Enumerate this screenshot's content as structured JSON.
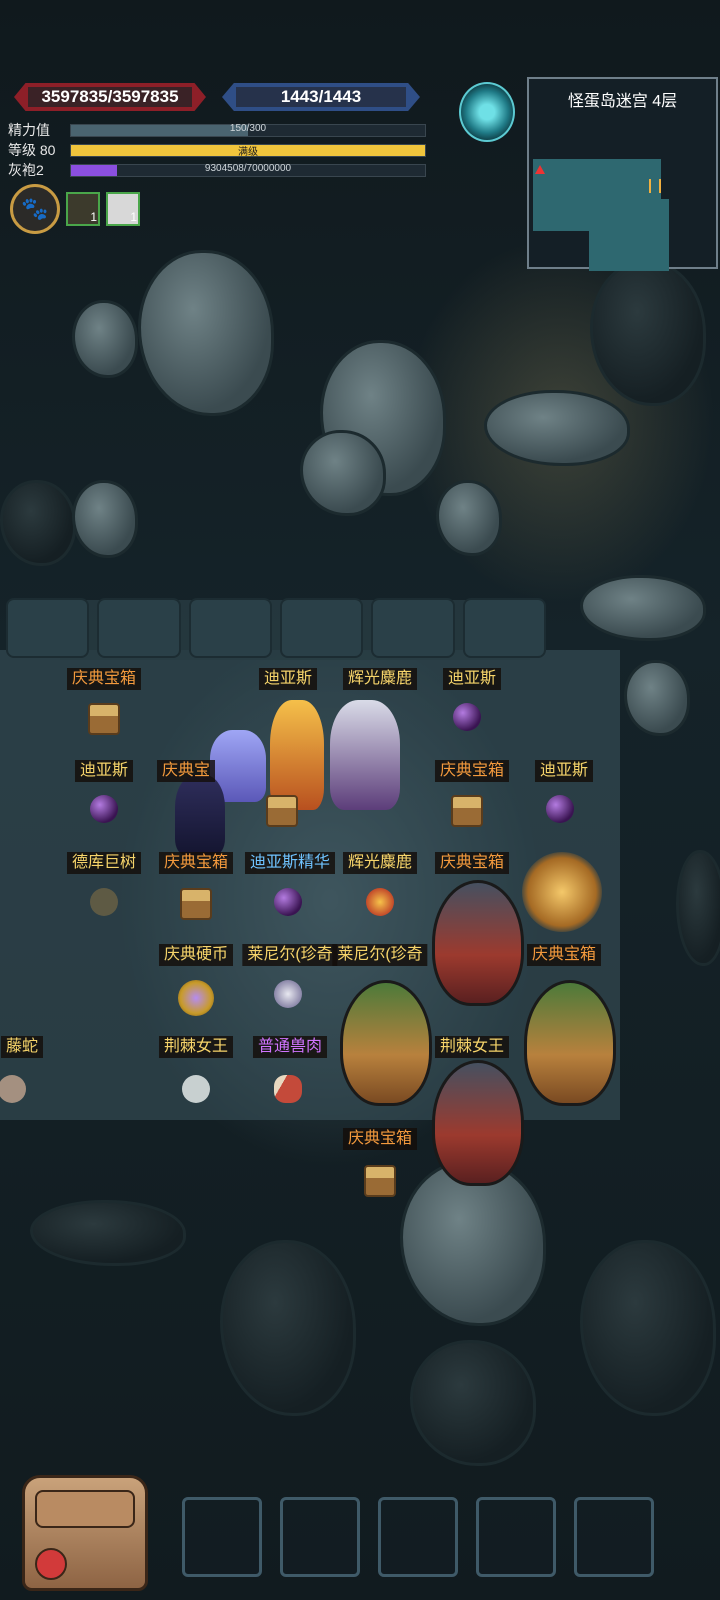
{
  "hud": {
    "hp": "3597835/3597835",
    "mp": "1443/1443",
    "stats": [
      {
        "label": "精力值",
        "text": "150/300",
        "fill": 0.5,
        "color": "#4a6470"
      },
      {
        "label": "等级 80",
        "text": "满级",
        "fill": 1.0,
        "color": "#f0c53c"
      },
      {
        "label": "灰袍2",
        "text": "9304508/70000000",
        "fill": 0.13,
        "color": "#8b4fe0"
      }
    ],
    "buffs": [
      {
        "icon": "armor-buff-icon",
        "count": "1"
      },
      {
        "icon": "ghost-buff-icon",
        "count": "1"
      }
    ]
  },
  "minimap": {
    "title": "怪蛋岛迷宫 4层"
  },
  "labels": [
    {
      "text": "庆典宝箱",
      "color": "orange"
    },
    {
      "text": "迪亚斯",
      "color": "gold"
    },
    {
      "text": "辉光麋鹿",
      "color": "gold"
    },
    {
      "text": "迪亚斯",
      "color": "gold"
    },
    {
      "text": "迪亚斯",
      "color": "gold"
    },
    {
      "text": "庆典宝",
      "color": "orange"
    },
    {
      "text": "庆典宝箱",
      "color": "orange"
    },
    {
      "text": "迪亚斯",
      "color": "gold"
    },
    {
      "text": "德库巨树",
      "color": "gold"
    },
    {
      "text": "庆典宝箱",
      "color": "orange"
    },
    {
      "text": "迪亚斯精华",
      "color": "blue"
    },
    {
      "text": "辉光麋鹿",
      "color": "gold"
    },
    {
      "text": "庆典宝箱",
      "color": "orange"
    },
    {
      "text": "庆典硬币",
      "color": "gold"
    },
    {
      "text": "莱尼尔(珍奇",
      "color": "gold"
    },
    {
      "text": "莱尼尔(珍奇",
      "color": "gold"
    },
    {
      "text": "庆典宝箱",
      "color": "orange"
    },
    {
      "text": "藤蛇",
      "color": "gold"
    },
    {
      "text": "荆棘女王",
      "color": "gold"
    },
    {
      "text": "普通兽肉",
      "color": "purple"
    },
    {
      "text": "荆棘女王",
      "color": "gold"
    },
    {
      "text": "庆典宝箱",
      "color": "orange"
    }
  ],
  "colors": {
    "hp": "#8d1f28",
    "mp": "#2f4e86",
    "orange": "#f39a3d",
    "gold": "#f6d46a",
    "blue": "#6fc3ff",
    "purple": "#d074ff"
  },
  "inventory": {
    "backpack_icon": "backpack-icon",
    "slots": 5
  }
}
